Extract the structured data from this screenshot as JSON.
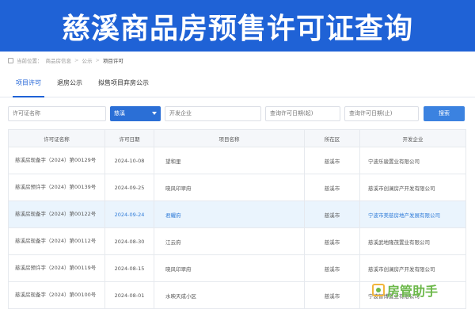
{
  "banner": {
    "title": "慈溪商品房预售许可证查询"
  },
  "breadcrumb": {
    "items": [
      "当前位置：",
      "商品房信息",
      "公示"
    ],
    "current": "项目许可"
  },
  "tabs": [
    {
      "label": "项目许可",
      "active": true
    },
    {
      "label": "退房公示",
      "active": false
    },
    {
      "label": "拟售项目弃房公示",
      "active": false
    }
  ],
  "filters": {
    "license_placeholder": "许可证名称",
    "district_value": "慈溪",
    "developer_placeholder": "开发企业",
    "date_start_placeholder": "查询许可日期(起)",
    "date_end_placeholder": "查询许可日期(止)",
    "search_label": "搜索"
  },
  "table": {
    "headers": [
      "许可证名称",
      "许可日期",
      "项目名称",
      "所在区",
      "开发企业"
    ],
    "rows": [
      {
        "license": "慈溪房现备字（2024）第00129号",
        "date": "2024-10-08",
        "project": "望和里",
        "district": "慈溪市",
        "developer": "宁波乐骏置业有限公司"
      },
      {
        "license": "慈溪房预许字（2024）第00139号",
        "date": "2024-09-25",
        "project": "晓风印翠府",
        "district": "慈溪市",
        "developer": "慈溪市创澜房产开发有限公司"
      },
      {
        "license": "慈溪房现备字（2024）第00122号",
        "date": "2024-09-24",
        "project": "君耀府",
        "district": "慈溪市",
        "developer": "宁波市美慈房地产发展有限公司"
      },
      {
        "license": "慈溪房现备字（2024）第00112号",
        "date": "2024-08-30",
        "project": "江云府",
        "district": "慈溪市",
        "developer": "慈溪武地隆茂置业有限公司"
      },
      {
        "license": "慈溪房预许字（2024）第00119号",
        "date": "2024-08-15",
        "project": "晓风印翠府",
        "district": "慈溪市",
        "developer": "慈溪市创澜房产开发有限公司"
      },
      {
        "license": "慈溪房现备字（2024）第00100号",
        "date": "2024-08-01",
        "project": "水映天成小区",
        "district": "慈溪市",
        "developer": "宁波智博置业有限公司"
      }
    ]
  },
  "watermark": {
    "text": "房管助手"
  },
  "colors": {
    "brand": "#1f62d6",
    "highlight_row": "#eaf4fd",
    "link": "#2f7bd8"
  }
}
